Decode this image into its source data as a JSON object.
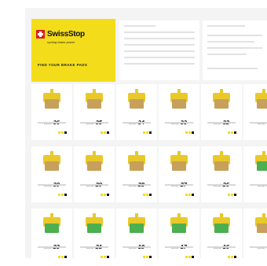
{
  "brand": {
    "logo_text": "SwissStop",
    "tagline": "cycling brake power",
    "cta": "FIND YOUR BRAKE PADS"
  },
  "colors": {
    "brand_yellow": "#f3dd1b",
    "pad_compound": "#c7a05a",
    "pad_compound_green": "#4caf50",
    "plate_yellow": "#e9c92a",
    "logo_red": "#d62027"
  },
  "pads": [
    {
      "prefix": "DISC",
      "code": "36",
      "compound": "tan"
    },
    {
      "prefix": "DISC",
      "code": "35",
      "compound": "tan"
    },
    {
      "prefix": "DISC",
      "code": "34",
      "compound": "tan"
    },
    {
      "prefix": "DISC",
      "code": "33",
      "compound": "tan"
    },
    {
      "prefix": "DISC",
      "code": "32",
      "compound": "tan"
    },
    {
      "prefix": "DISC",
      "code": "3",
      "compound": "tan"
    },
    {
      "prefix": "DISC",
      "code": "30",
      "compound": "tan"
    },
    {
      "prefix": "DISC",
      "code": "29",
      "compound": "tan"
    },
    {
      "prefix": "DISC",
      "code": "28",
      "compound": "tan"
    },
    {
      "prefix": "DISC",
      "code": "27",
      "compound": "tan"
    },
    {
      "prefix": "DISC",
      "code": "26",
      "compound": "tan"
    },
    {
      "prefix": "DISC",
      "code": "2",
      "compound": "green"
    },
    {
      "prefix": "DISC",
      "code": "23",
      "compound": "green"
    },
    {
      "prefix": "DISC",
      "code": "21",
      "compound": "green"
    },
    {
      "prefix": "DISC",
      "code": "18",
      "compound": "green"
    },
    {
      "prefix": "DISC",
      "code": "17",
      "compound": "green"
    },
    {
      "prefix": "DISC",
      "code": "16",
      "compound": "green"
    },
    {
      "prefix": "DISC",
      "code": "1",
      "compound": "tan"
    }
  ]
}
